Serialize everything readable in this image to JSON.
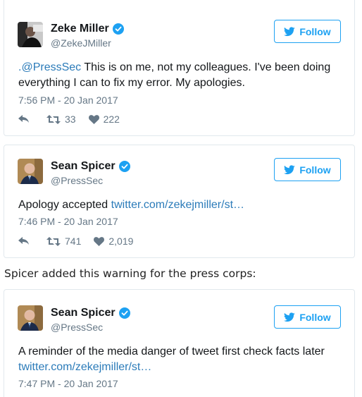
{
  "tweets": [
    {
      "name": "Zeke Miller",
      "handle": "@ZekeJMiller",
      "follow_label": "Follow",
      "text_mention": ".@PressSec",
      "text_body": " This is on me, not my colleagues. I've been doing everything I can to fix my error. My apologies.",
      "timestamp": "7:56 PM - 20 Jan 2017",
      "retweets": "33",
      "likes": "222"
    },
    {
      "name": "Sean Spicer",
      "handle": "@PressSec",
      "follow_label": "Follow",
      "text_body": "Apology accepted ",
      "text_link": "twitter.com/zekejmiller/st…",
      "timestamp": "7:46 PM - 20 Jan 2017",
      "retweets": "741",
      "likes": "2,019"
    },
    {
      "name": "Sean Spicer",
      "handle": "@PressSec",
      "follow_label": "Follow",
      "text_body": "A reminder of the media danger of tweet first check facts later ",
      "text_link": "twitter.com/zekejmiller/st…",
      "timestamp": "7:47 PM - 20 Jan 2017"
    }
  ],
  "caption": "Spicer added this warning for the press corps:",
  "colors": {
    "twitter_blue": "#1da1f2",
    "link_blue": "#2b7bb9",
    "meta_gray": "#657786",
    "border": "#e1e8ed"
  },
  "icons": [
    "verified-badge-icon",
    "twitter-bird-icon",
    "reply-icon",
    "retweet-icon",
    "heart-icon"
  ]
}
